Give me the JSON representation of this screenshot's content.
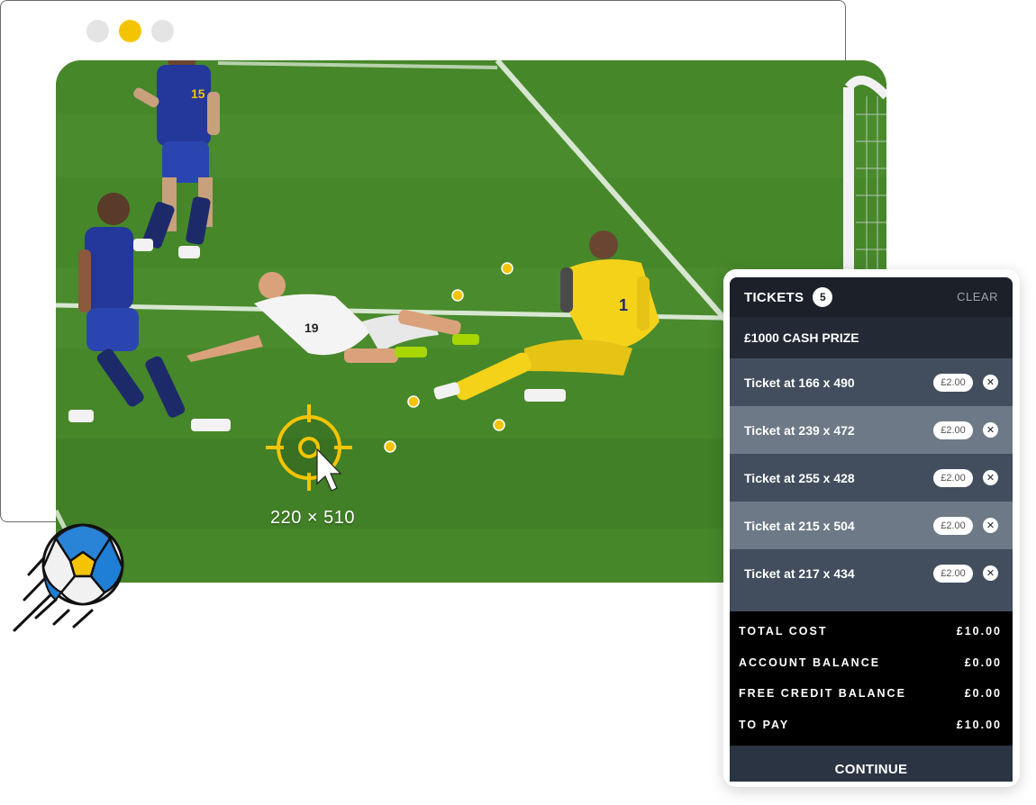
{
  "window_controls": {
    "colors": [
      "#e4e4e4",
      "#f5c400",
      "#e4e4e4"
    ]
  },
  "game": {
    "crosshair_color": "#f5c400",
    "coordinate_label": "220 × 510",
    "marker_color": "#f5c400"
  },
  "tickets_panel": {
    "title": "TICKETS",
    "count": "5",
    "clear_label": "CLEAR",
    "prize_label": "£1000 CASH PRIZE",
    "tickets": [
      {
        "label": "Ticket at 166 x 490",
        "price": "£2.00"
      },
      {
        "label": "Ticket at 239 x 472",
        "price": "£2.00"
      },
      {
        "label": "Ticket at 255 x 428",
        "price": "£2.00"
      },
      {
        "label": "Ticket at 215 x 504",
        "price": "£2.00"
      },
      {
        "label": "Ticket at 217 x 434",
        "price": "£2.00"
      }
    ],
    "remove_icon": "close-icon",
    "summary": [
      {
        "label": "TOTAL COST",
        "value": "£10.00"
      },
      {
        "label": "ACCOUNT BALANCE",
        "value": "£0.00"
      },
      {
        "label": "FREE CREDIT BALANCE",
        "value": "£0.00"
      },
      {
        "label": "TO PAY",
        "value": "£10.00"
      }
    ],
    "continue_label": "CONTINUE"
  },
  "decoration": {
    "ball_icon": "soccer-ball-icon"
  }
}
